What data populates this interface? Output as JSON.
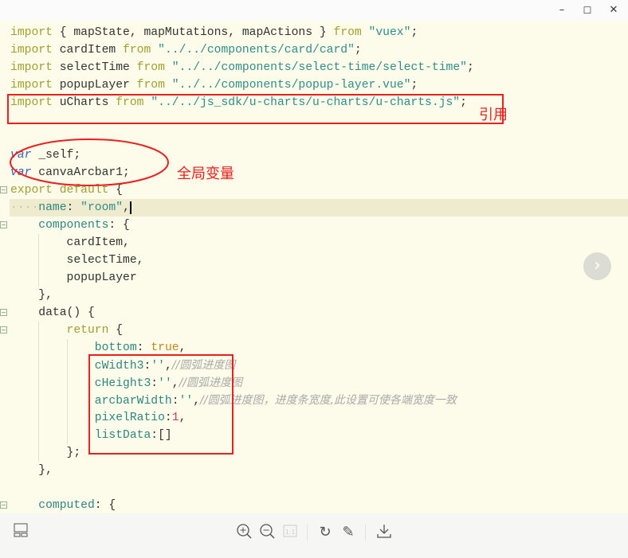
{
  "window": {
    "minimize_icon": "–",
    "maximize_icon": "☐",
    "close_icon": "✕"
  },
  "code_lines": [
    [
      [
        "import",
        "kw"
      ],
      [
        " { mapState, mapMutations, mapActions } ",
        ""
      ],
      [
        "from",
        "kw"
      ],
      [
        " ",
        ""
      ],
      [
        "\"vuex\"",
        "str"
      ],
      [
        ";",
        ""
      ]
    ],
    [
      [
        "import",
        "kw"
      ],
      [
        " cardItem ",
        ""
      ],
      [
        "from",
        "kw"
      ],
      [
        " ",
        ""
      ],
      [
        "\"../../components/card/card\"",
        "str"
      ],
      [
        ";",
        ""
      ]
    ],
    [
      [
        "import",
        "kw"
      ],
      [
        " selectTime ",
        ""
      ],
      [
        "from",
        "kw"
      ],
      [
        " ",
        ""
      ],
      [
        "\"../../components/select-time/select-time\"",
        "str"
      ],
      [
        ";",
        ""
      ]
    ],
    [
      [
        "import",
        "kw"
      ],
      [
        " popupLayer ",
        ""
      ],
      [
        "from",
        "kw"
      ],
      [
        " ",
        ""
      ],
      [
        "\"../../components/popup-layer.vue\"",
        "str"
      ],
      [
        ";",
        ""
      ]
    ],
    [
      [
        "import",
        "kw"
      ],
      [
        " uCharts ",
        ""
      ],
      [
        "from",
        "kw"
      ],
      [
        " ",
        ""
      ],
      [
        "\"../../js_sdk/u-charts/u-charts/u-charts.js\"",
        "str"
      ],
      [
        ";",
        ""
      ]
    ],
    [],
    [],
    [
      [
        "var",
        "var"
      ],
      [
        " _self;",
        ""
      ]
    ],
    [
      [
        "var",
        "var"
      ],
      [
        " canvaArcbar1;",
        ""
      ]
    ],
    [
      [
        "export",
        "kw"
      ],
      [
        " ",
        ""
      ],
      [
        "default",
        "kw"
      ],
      [
        " {",
        ""
      ]
    ],
    [
      [
        "····",
        "dots"
      ],
      [
        "name",
        "prop"
      ],
      [
        ": ",
        ""
      ],
      [
        "\"room\"",
        "str"
      ],
      [
        ",",
        ""
      ]
    ],
    [
      [
        "    ",
        ""
      ],
      [
        "components",
        "prop"
      ],
      [
        ": {",
        ""
      ]
    ],
    [
      [
        "        cardItem,",
        ""
      ]
    ],
    [
      [
        "        selectTime,",
        ""
      ]
    ],
    [
      [
        "        popupLayer",
        ""
      ]
    ],
    [
      [
        "    },",
        ""
      ]
    ],
    [
      [
        "    data() {",
        ""
      ]
    ],
    [
      [
        "        ",
        ""
      ],
      [
        "return",
        "kw"
      ],
      [
        " {",
        ""
      ]
    ],
    [
      [
        "            ",
        ""
      ],
      [
        "bottom",
        "prop"
      ],
      [
        ": ",
        ""
      ],
      [
        "true",
        "bool"
      ],
      [
        ",",
        ""
      ]
    ],
    [
      [
        "            ",
        ""
      ],
      [
        "cWidth3",
        "prop"
      ],
      [
        ":",
        ""
      ],
      [
        "''",
        "str"
      ],
      [
        ",",
        ""
      ],
      [
        "//圆弧进度图",
        "cm"
      ]
    ],
    [
      [
        "            ",
        ""
      ],
      [
        "cHeight3",
        "prop"
      ],
      [
        ":",
        ""
      ],
      [
        "''",
        "str"
      ],
      [
        ",",
        ""
      ],
      [
        "//圆弧进度图",
        "cm"
      ]
    ],
    [
      [
        "            ",
        ""
      ],
      [
        "arcbarWidth",
        "prop"
      ],
      [
        ":",
        ""
      ],
      [
        "''",
        "str"
      ],
      [
        ",",
        ""
      ],
      [
        "//圆弧进度图，进度条宽度,此设置可使各端宽度一致",
        "cm"
      ]
    ],
    [
      [
        "            ",
        ""
      ],
      [
        "pixelRatio",
        "prop"
      ],
      [
        ":",
        ""
      ],
      [
        "1",
        "num"
      ],
      [
        ",",
        ""
      ]
    ],
    [
      [
        "            ",
        ""
      ],
      [
        "listData",
        "prop"
      ],
      [
        ":[]",
        ""
      ]
    ],
    [
      [
        "        };",
        ""
      ]
    ],
    [
      [
        "    },",
        ""
      ]
    ],
    [],
    [
      [
        "    ",
        ""
      ],
      [
        "computed",
        "prop"
      ],
      [
        ": {",
        ""
      ]
    ]
  ],
  "annotations": {
    "import_label": "引用",
    "globals_label": "全局变量"
  },
  "colors": {
    "annotation": "#e8201e",
    "background": "#fdfbe9"
  },
  "toolbar": {
    "thumbnails_icon": "layout-icon",
    "zoom_in_icon": "zoom-in",
    "zoom_out_icon": "zoom-out",
    "actual_size_icon": "1:1",
    "rotate_icon": "rotate",
    "edit_icon": "pencil",
    "download_icon": "download"
  }
}
